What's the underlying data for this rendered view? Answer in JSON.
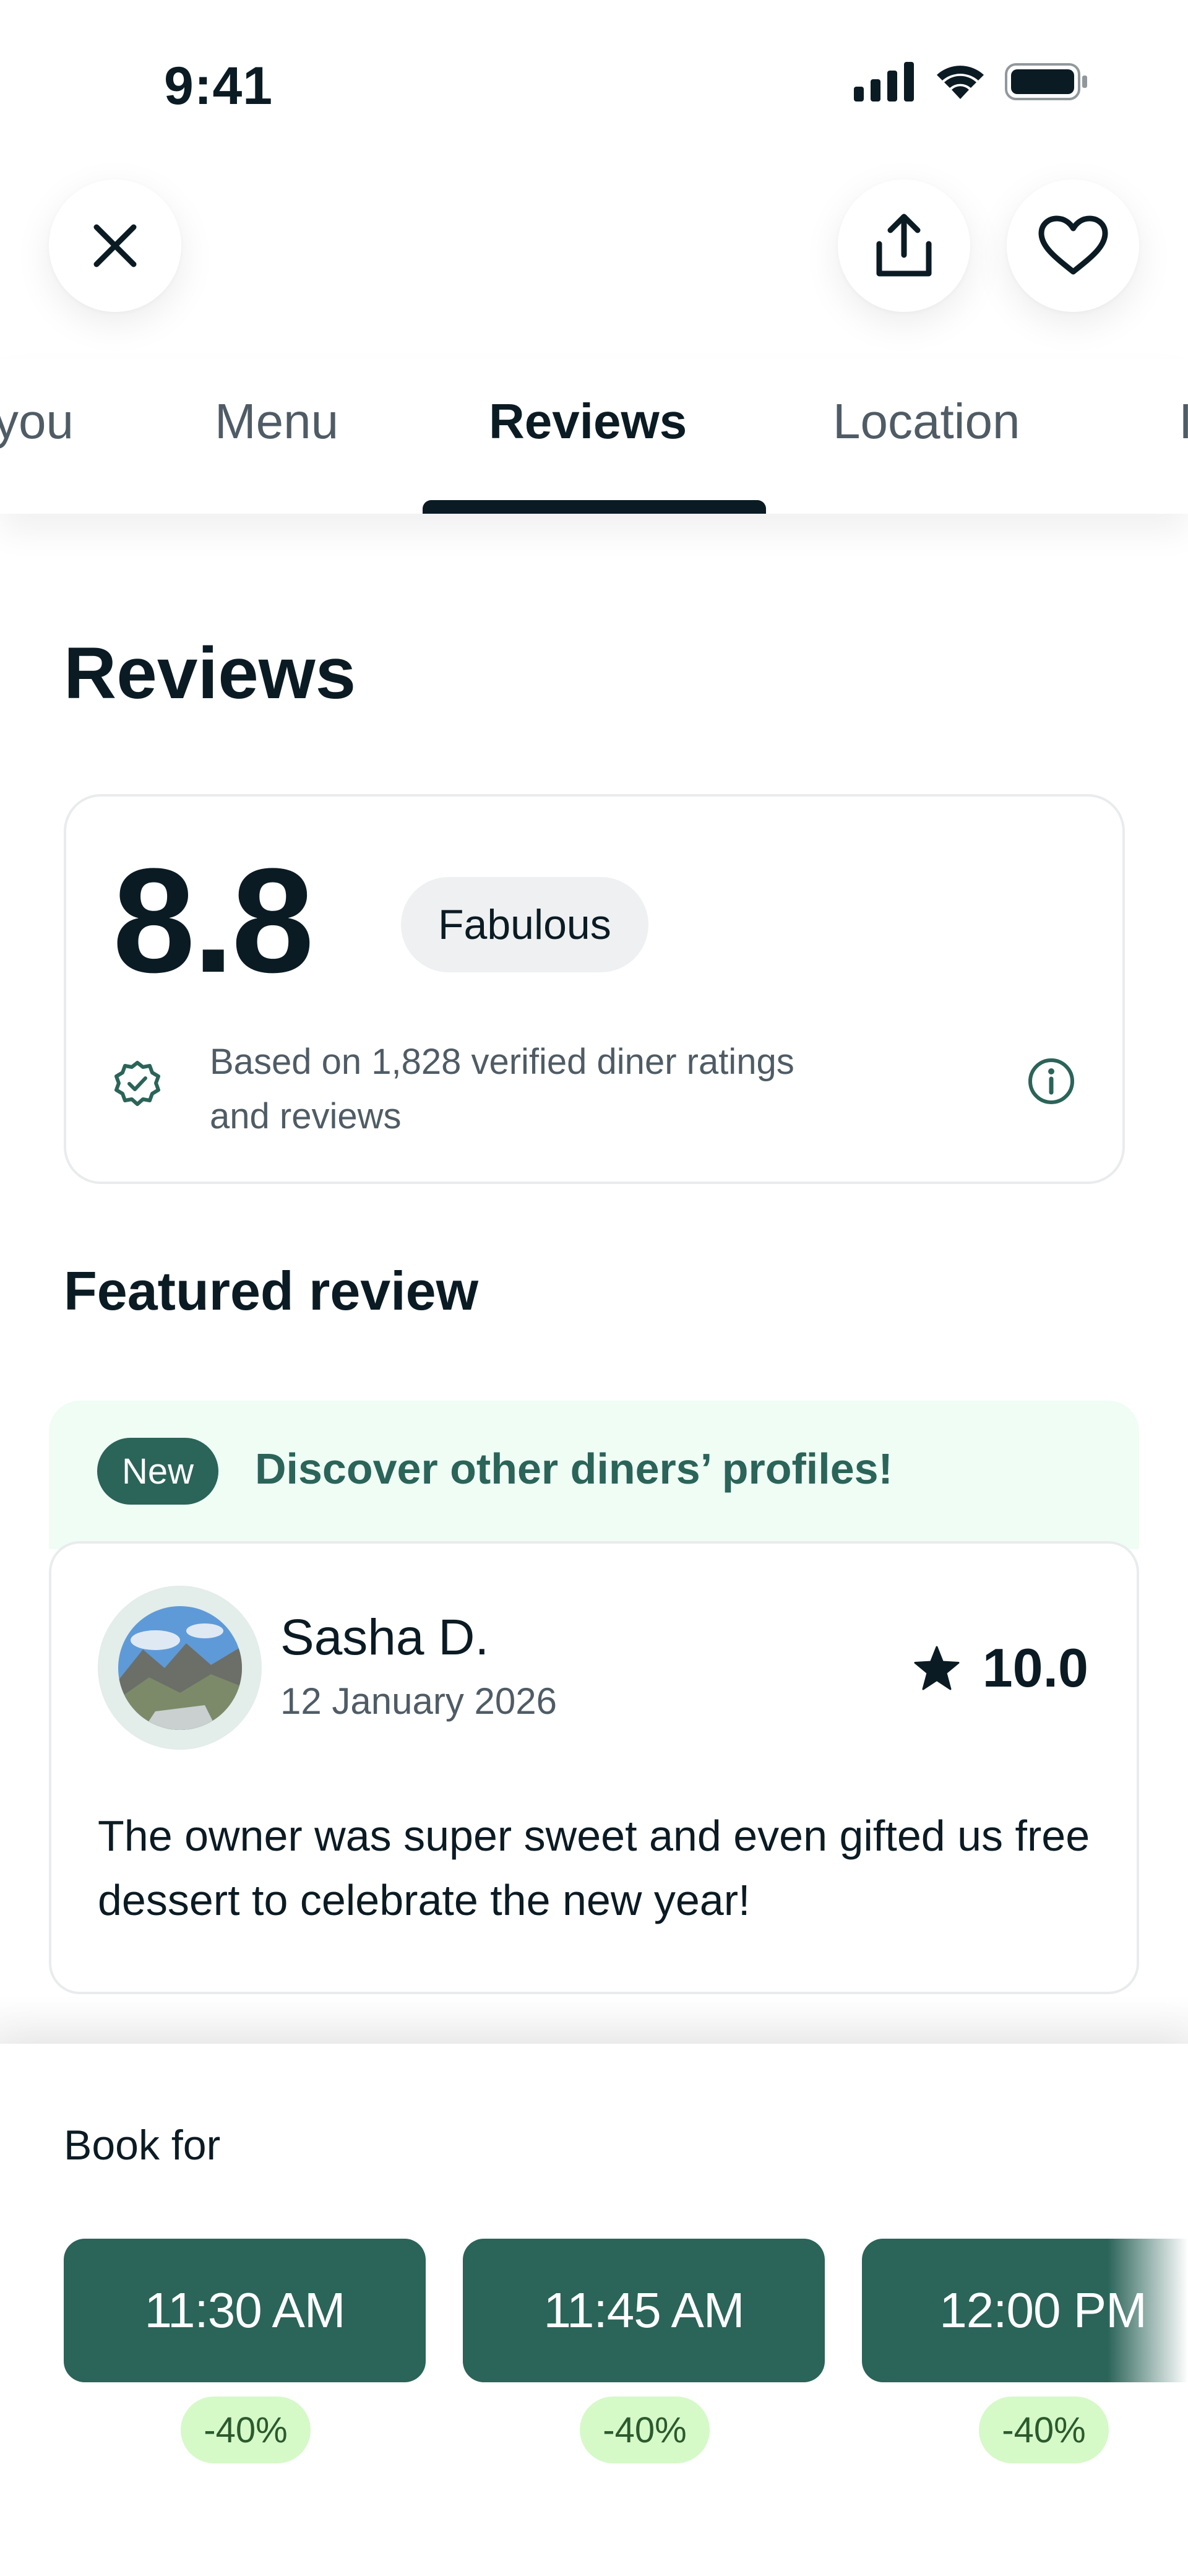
{
  "status_bar": {
    "time": "9:41"
  },
  "tabs": [
    {
      "label": "you"
    },
    {
      "label": "Menu"
    },
    {
      "label": "Reviews"
    },
    {
      "label": "Location"
    },
    {
      "label": "I"
    }
  ],
  "reviews": {
    "title": "Reviews",
    "score": "8.8",
    "score_label": "Fabulous",
    "description_line1": "Based on 1,828 verified diner ratings",
    "description_line2": "and reviews"
  },
  "featured": {
    "title": "Featured review",
    "banner_badge": "New",
    "banner_text": "Discover other diners’ profiles!",
    "reviewer_name": "Sasha D.",
    "review_date": "12 January 2026",
    "rating": "10.0",
    "review_text": "The owner was super sweet and even gifted us free dessert to celebrate the new year!"
  },
  "booking": {
    "label": "Book for",
    "slots": [
      {
        "time": "11:30 AM",
        "discount": "-40%"
      },
      {
        "time": "11:45 AM",
        "discount": "-40%"
      },
      {
        "time": "12:00 PM",
        "discount": "-40%"
      }
    ]
  },
  "colors": {
    "brand_green": "#2b6459",
    "banner_bg": "#effdf5",
    "discount_bg": "#d6f9c8",
    "text_primary": "#0b1b24",
    "text_secondary": "#4f5c65"
  },
  "icons": [
    "close-icon",
    "share-icon",
    "heart-icon",
    "verified-icon",
    "info-icon",
    "star-icon",
    "signal-icon",
    "wifi-icon",
    "battery-icon"
  ]
}
